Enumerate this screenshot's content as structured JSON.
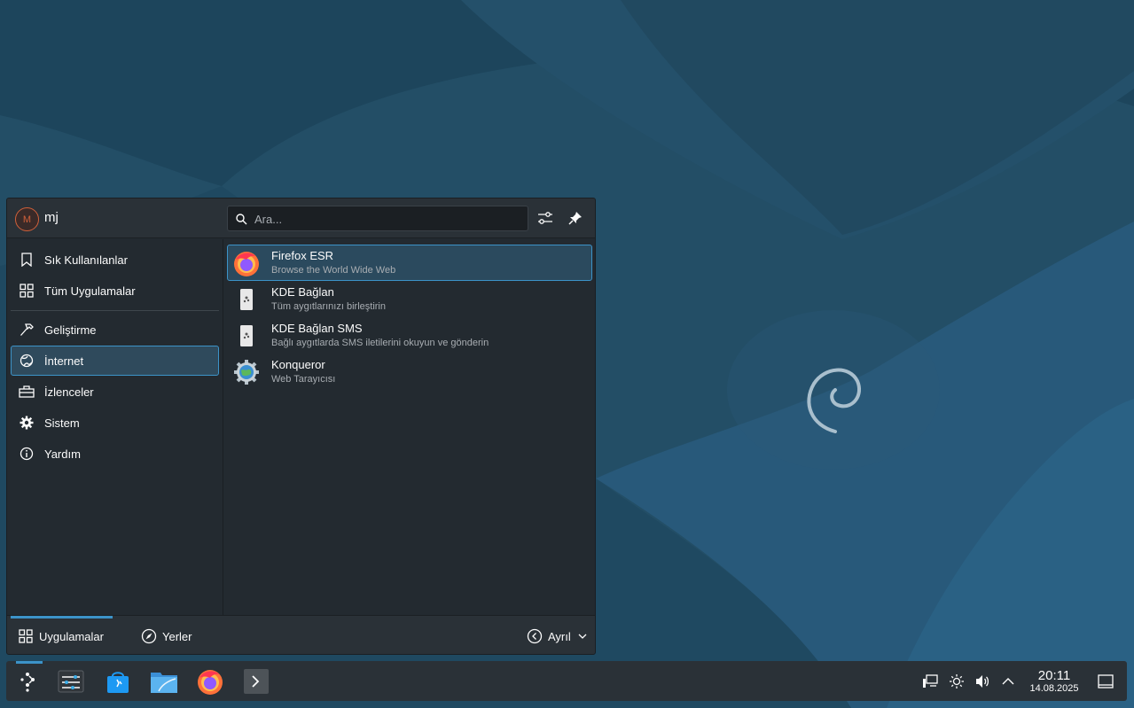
{
  "colors": {
    "accent": "#3c93c8",
    "panel_bg": "#2a3137",
    "menu_bg": "#232a30",
    "wallpaper": "#1f4a64"
  },
  "launcher": {
    "user": {
      "initial": "M",
      "name": "mj"
    },
    "search": {
      "placeholder": "Ara..."
    },
    "categories": [
      {
        "label": "Sık Kullanılanlar",
        "icon": "bookmark-icon"
      },
      {
        "label": "Tüm Uygulamalar",
        "icon": "grid-icon"
      },
      {
        "label": "Geliştirme",
        "icon": "hammer-icon"
      },
      {
        "label": "İnternet",
        "icon": "globe-icon",
        "active": true
      },
      {
        "label": "İzlenceler",
        "icon": "toolbox-icon"
      },
      {
        "label": "Sistem",
        "icon": "gear-icon"
      },
      {
        "label": "Yardım",
        "icon": "info-icon"
      }
    ],
    "apps": [
      {
        "name": "Firefox ESR",
        "desc": "Browse the World Wide Web",
        "icon": "firefox-icon",
        "active": true
      },
      {
        "name": "KDE Bağlan",
        "desc": "Tüm aygıtlarınızı birleştirin",
        "icon": "kdeconnect-icon"
      },
      {
        "name": "KDE Bağlan SMS",
        "desc": "Bağlı aygıtlarda SMS iletilerini okuyun ve gönderin",
        "icon": "kdeconnect-sms-icon"
      },
      {
        "name": "Konqueror",
        "desc": "Web Tarayıcısı",
        "icon": "konqueror-icon"
      }
    ],
    "footer": {
      "applications_label": "Uygulamalar",
      "places_label": "Yerler",
      "power_label": "Ayrıl"
    }
  },
  "taskbar": {
    "items": [
      "app-launcher-icon",
      "system-settings-icon",
      "discover-icon",
      "dolphin-icon",
      "firefox-icon",
      "konsole-icon"
    ],
    "tray": [
      "network-icon",
      "brightness-icon",
      "volume-icon",
      "expand-tray-icon"
    ],
    "clock": {
      "time": "20:11",
      "date": "14.08.2025"
    }
  }
}
